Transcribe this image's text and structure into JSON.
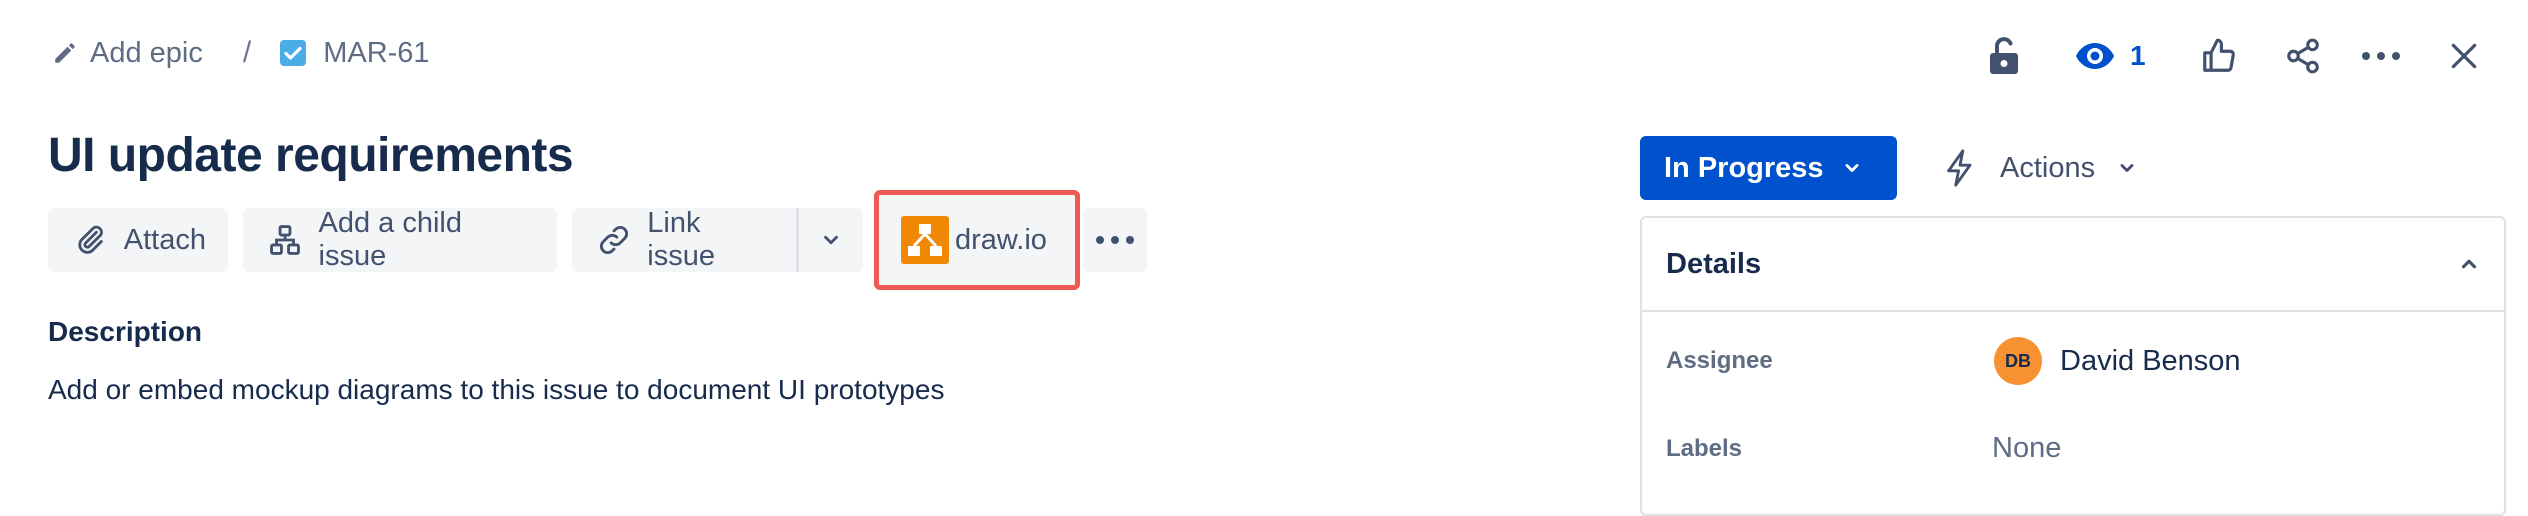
{
  "breadcrumb": {
    "add_epic_label": "Add epic",
    "separator": "/",
    "issue_key": "MAR-61"
  },
  "issue": {
    "title": "UI update requirements"
  },
  "toolbar": {
    "attach_label": "Attach",
    "add_child_label": "Add a child issue",
    "link_issue_label": "Link issue",
    "drawio_label": "draw.io"
  },
  "description": {
    "heading": "Description",
    "text": "Add or embed mockup diagrams to this issue to document UI prototypes"
  },
  "header_actions": {
    "watch_count": "1"
  },
  "status": {
    "label": "In Progress",
    "actions_label": "Actions"
  },
  "details": {
    "title": "Details",
    "fields": [
      {
        "label": "Assignee",
        "value": "David Benson",
        "initials": "DB"
      },
      {
        "label": "Labels",
        "value": "None"
      }
    ]
  },
  "colors": {
    "primary": "#0052cc",
    "highlight": "#ef5a55",
    "drawio": "#f08705",
    "avatar": "#f79232"
  }
}
